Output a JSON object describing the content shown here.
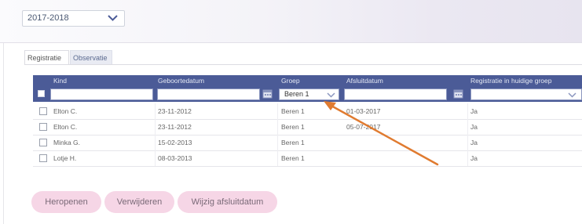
{
  "year_select": {
    "value": "2017-2018",
    "icon": "chevron-down-icon"
  },
  "tabs": [
    {
      "label": "Registratie",
      "active": true
    },
    {
      "label": "Observatie",
      "active": false
    }
  ],
  "table": {
    "headers": [
      "Kind",
      "Geboortedatum",
      "Groep",
      "Afsluitdatum",
      "Registratie in huidige groep"
    ],
    "filters": {
      "groep": "Beren 1"
    },
    "rows": [
      {
        "kind": "Elton C.",
        "geboortedatum": "23-11-2012",
        "groep": "Beren 1",
        "afsluitdatum": "01-03-2017",
        "registratie": "Ja"
      },
      {
        "kind": "Elton C.",
        "geboortedatum": "23-11-2012",
        "groep": "Beren 1",
        "afsluitdatum": "05-07-2017",
        "registratie": "Ja"
      },
      {
        "kind": "Minka G.",
        "geboortedatum": "15-02-2013",
        "groep": "Beren 1",
        "afsluitdatum": "",
        "registratie": "Ja"
      },
      {
        "kind": "Lotje H.",
        "geboortedatum": "08-03-2013",
        "groep": "Beren 1",
        "afsluitdatum": "",
        "registratie": "Ja"
      }
    ]
  },
  "buttons": {
    "reopen": "Heropenen",
    "delete": "Verwijderen",
    "change_close_date": "Wijzig afsluitdatum"
  },
  "colors": {
    "header": "#4b5b97",
    "button": "#f6d6e6",
    "arrow": "#e07b30"
  }
}
